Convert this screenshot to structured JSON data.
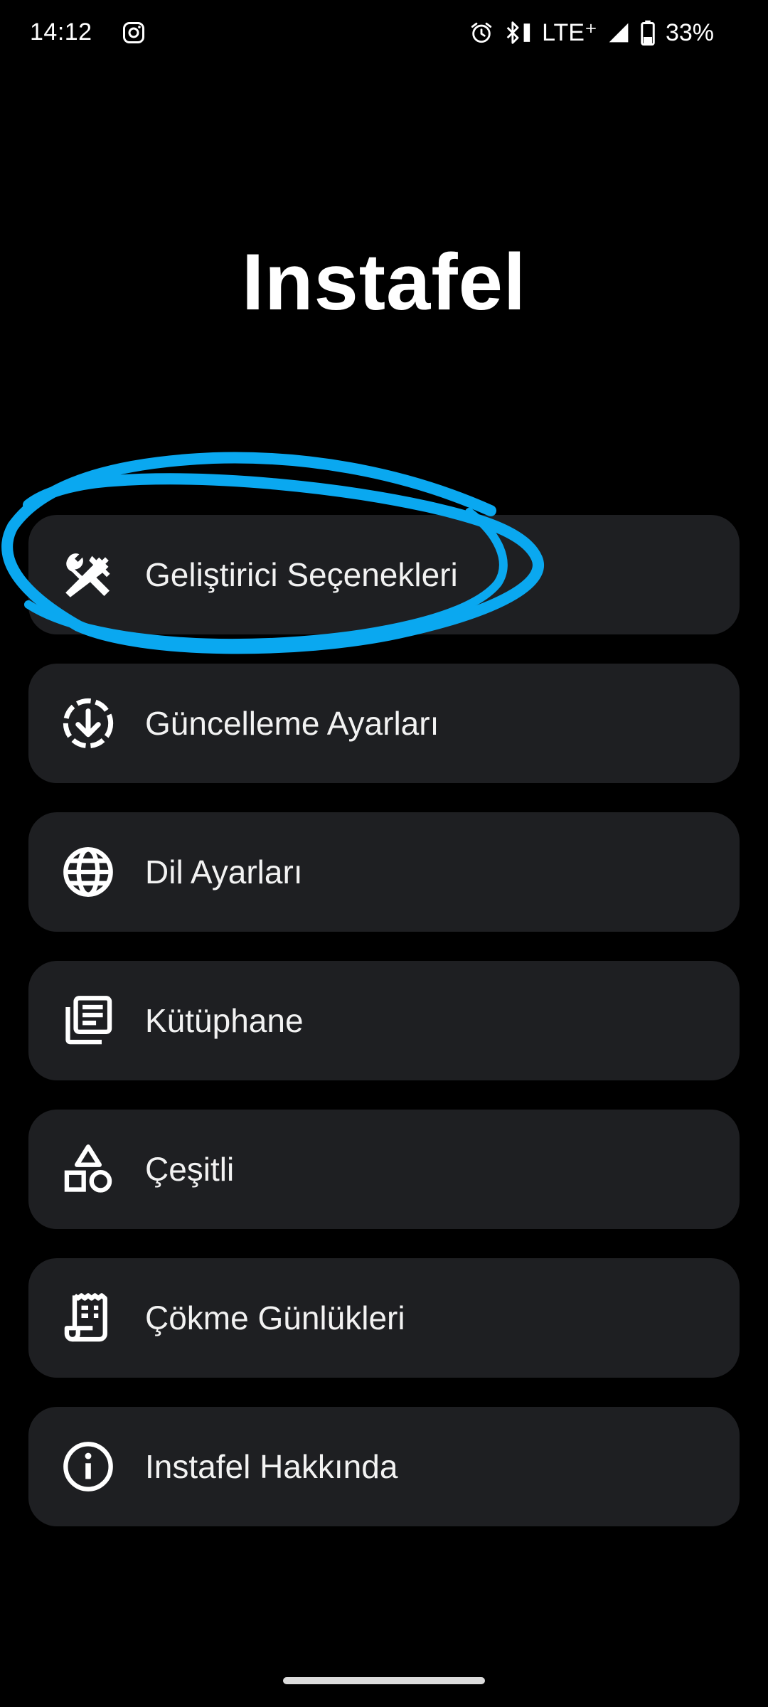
{
  "status_bar": {
    "time": "14:12",
    "network": "LTE⁺",
    "battery": "33%",
    "icons": [
      "instagram-icon",
      "alarm-icon",
      "bluetooth-icon",
      "signal-icon",
      "battery-icon"
    ]
  },
  "app": {
    "title": "Instafel"
  },
  "menu": {
    "items": [
      {
        "label": "Geliştirici Seçenekleri",
        "icon": "tools-icon"
      },
      {
        "label": "Güncelleme Ayarları",
        "icon": "download-circle-icon"
      },
      {
        "label": "Dil Ayarları",
        "icon": "globe-icon"
      },
      {
        "label": "Kütüphane",
        "icon": "library-icon"
      },
      {
        "label": "Çeşitli",
        "icon": "shapes-icon"
      },
      {
        "label": "Çökme Günlükleri",
        "icon": "receipt-icon"
      },
      {
        "label": "Instafel Hakkında",
        "icon": "info-icon"
      }
    ]
  },
  "colors": {
    "background": "#000000",
    "card": "#1e1f22",
    "text": "#ffffff",
    "annotation": "#0aa8f0"
  }
}
